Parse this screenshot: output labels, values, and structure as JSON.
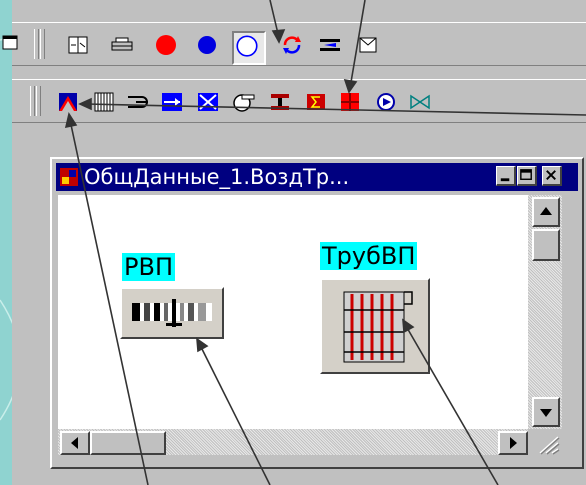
{
  "window": {
    "title": "ОбщДанные_1.ВоздТр...",
    "objects": [
      {
        "label": "РВП",
        "icon": "regenerative-air-heater-icon"
      },
      {
        "label": "ТрубВП",
        "icon": "tubular-air-heater-icon"
      }
    ]
  },
  "toolbar1": {
    "items": [
      "window-icon",
      "panel-icon",
      "tank-icon",
      "red-circle-icon",
      "blue-circle-icon",
      "circle-outline-icon",
      "refresh-icon",
      "valve-bar-icon",
      "envelope-icon"
    ],
    "pressed": "circle-outline-icon"
  },
  "toolbar2": {
    "items": [
      "mixer-icon",
      "regenerator-icon",
      "loop-icon",
      "heat-exchanger-icon",
      "mixing-exchanger-icon",
      "fan-icon",
      "air-heater-icon",
      "sigma-icon",
      "heater-block-icon",
      "pump-icon",
      "gate-valve-icon"
    ]
  },
  "colors": {
    "background": "#8fd3d0",
    "titlebar": "#000080",
    "label_highlight": "#00ffff"
  }
}
